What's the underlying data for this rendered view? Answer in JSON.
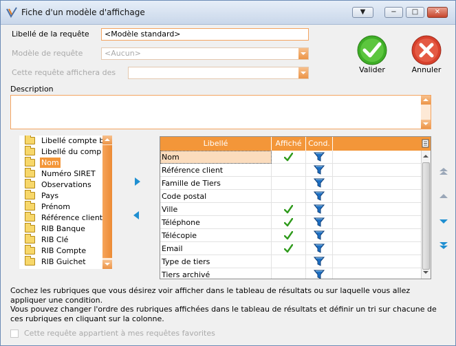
{
  "window": {
    "title": "Fiche d'un modèle d'affichage",
    "controls": {
      "menu": "▼",
      "minimize": "−",
      "maximize": "□",
      "close": "✕"
    }
  },
  "form": {
    "libelle_label": "Libellé de la requête",
    "libelle_value": "<Modèle standard>",
    "modele_label": "Modèle de requête",
    "modele_value": "<Aucun>",
    "affichera_label": "Cette requête affichera des",
    "affichera_value": "",
    "description_label": "Description",
    "description_value": ""
  },
  "actions": {
    "valider": "Valider",
    "annuler": "Annuler",
    "valider_color": "#3fae27",
    "annuler_color": "#d8412d"
  },
  "tree": {
    "items": [
      {
        "label": "Libellé compte b",
        "selected": false
      },
      {
        "label": "Libellé du comp",
        "selected": false
      },
      {
        "label": "Nom",
        "selected": true
      },
      {
        "label": "Numéro SIRET",
        "selected": false
      },
      {
        "label": "Observations",
        "selected": false
      },
      {
        "label": "Pays",
        "selected": false
      },
      {
        "label": "Prénom",
        "selected": false
      },
      {
        "label": "Référence client",
        "selected": false
      },
      {
        "label": "RIB Banque",
        "selected": false
      },
      {
        "label": "RIB Clé",
        "selected": false
      },
      {
        "label": "RIB Compte",
        "selected": false
      },
      {
        "label": "RIB Guichet",
        "selected": false
      }
    ]
  },
  "grid": {
    "headers": [
      "Libellé",
      "Affiché",
      "Cond."
    ],
    "rows": [
      {
        "libelle": "Nom",
        "affiche": true,
        "selected": true
      },
      {
        "libelle": "Référence client",
        "affiche": false,
        "selected": false
      },
      {
        "libelle": "Famille de Tiers",
        "affiche": false,
        "selected": false
      },
      {
        "libelle": "Code postal",
        "affiche": false,
        "selected": false
      },
      {
        "libelle": "Ville",
        "affiche": true,
        "selected": false
      },
      {
        "libelle": "Téléphone",
        "affiche": true,
        "selected": false
      },
      {
        "libelle": "Télécopie",
        "affiche": true,
        "selected": false
      },
      {
        "libelle": "Email",
        "affiche": true,
        "selected": false
      },
      {
        "libelle": "Type de tiers",
        "affiche": false,
        "selected": false
      },
      {
        "libelle": "Tiers archivé",
        "affiche": false,
        "selected": false
      }
    ],
    "header_color": "#f39639"
  },
  "help": {
    "line1": "Cochez les rubriques que vous désirez voir afficher dans le tableau de résultats ou sur laquelle vous allez appliquer une condition.",
    "line2": "Vous pouvez changer l'ordre des rubriques affichées dans le tableau de résultats et définir un tri sur chacune de ces rubriques en cliquant sur la colonne."
  },
  "favorite": {
    "label": "Cette requête appartient à mes requêtes favorites",
    "checked": false
  },
  "icons": [
    "app-icon",
    "checkmark-icon",
    "cross-icon",
    "folder-icon",
    "funnel-icon",
    "arrow-right-icon",
    "arrow-left-icon",
    "move-top-icon",
    "move-up-icon",
    "move-down-icon",
    "move-bottom-icon",
    "column-config-icon"
  ]
}
